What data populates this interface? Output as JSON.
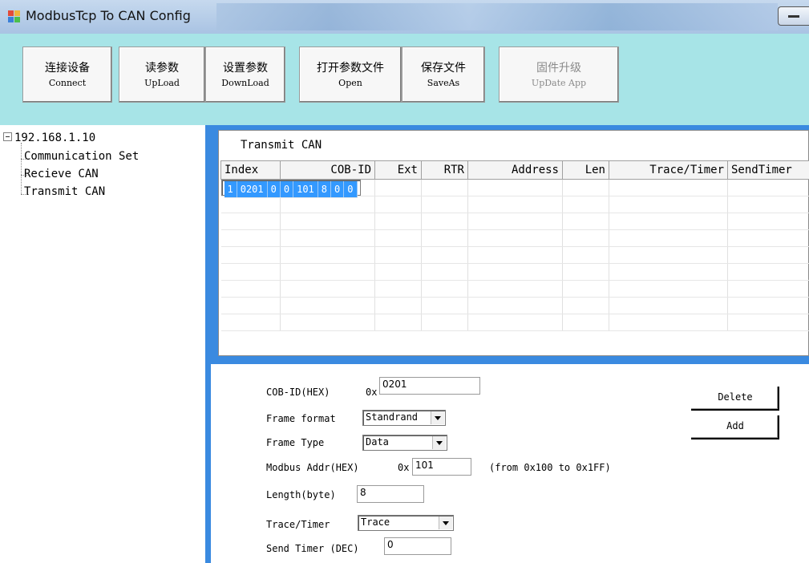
{
  "window": {
    "title": "ModbusTcp To CAN Config"
  },
  "toolbar": {
    "buttons": [
      {
        "cn": "连接设备",
        "en": "Connect"
      },
      {
        "cn": "读参数",
        "en": "UpLoad"
      },
      {
        "cn": "设置参数",
        "en": "DownLoad"
      },
      {
        "cn": "打开参数文件",
        "en": "Open"
      },
      {
        "cn": "保存文件",
        "en": "SaveAs"
      },
      {
        "cn": "固件升级",
        "en": "UpDate App"
      }
    ]
  },
  "tree": {
    "root": "192.168.1.10",
    "children": [
      "Communication Set",
      "Recieve CAN",
      "Transmit CAN"
    ]
  },
  "group": {
    "title": "Transmit CAN"
  },
  "table": {
    "columns": [
      "Index",
      "COB-ID",
      "Ext",
      "RTR",
      "Address",
      "Len",
      "Trace/Timer",
      "SendTimer"
    ],
    "rows": [
      [
        "1",
        "0201",
        "0",
        "0",
        "101",
        "8",
        "0",
        "0"
      ]
    ]
  },
  "form": {
    "cobid_label": "COB-ID(HEX)",
    "cobid_prefix": "0x",
    "cobid_value": "0201",
    "frame_format_label": "Frame format",
    "frame_format_value": "Standrand",
    "frame_type_label": "Frame Type",
    "frame_type_value": "Data",
    "modbus_addr_label": "Modbus Addr(HEX)",
    "modbus_addr_prefix": "0x",
    "modbus_addr_value": "101",
    "modbus_addr_hint": "(from 0x100 to 0x1FF)",
    "length_label": "Length(byte)",
    "length_value": "8",
    "trace_label": "Trace/Timer",
    "trace_value": "Trace",
    "send_timer_label": "Send Timer (DEC)",
    "send_timer_value": "0",
    "delete_label": "Delete",
    "add_label": "Add"
  },
  "colors": {
    "toolbar_bg": "#a7e4e7",
    "panel_bg": "#3a8ae0",
    "selection": "#3399ff"
  },
  "icons": [
    "app-icon",
    "minimize-icon",
    "collapse-icon",
    "dropdown-arrow-icon"
  ]
}
